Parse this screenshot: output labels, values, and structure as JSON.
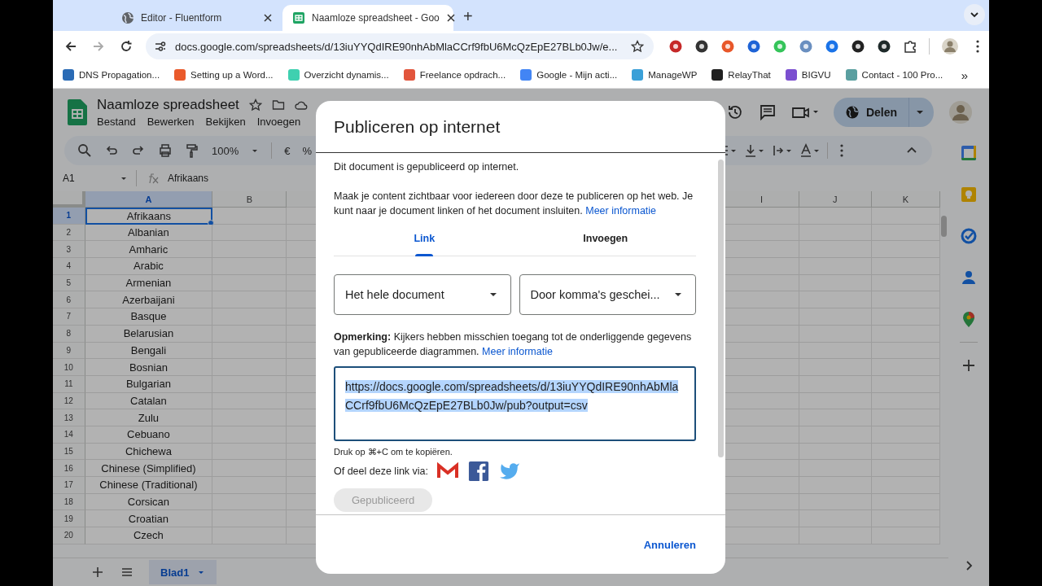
{
  "browser": {
    "tabs": [
      {
        "title": "Editor - Fluentform",
        "kind": "globe",
        "selected": false
      },
      {
        "title": "Naamloze spreadsheet - Goo",
        "kind": "sheets",
        "selected": true
      }
    ],
    "new_tab": "+",
    "url": "docs.google.com/spreadsheets/d/13iuYYQdIRE90nhAbMlaCCrf9fbU6McQzEpE27BLb0Jw/e...",
    "bookmarks": [
      {
        "label": "DNS Propagation...",
        "color": "#2a6bb5"
      },
      {
        "label": "Setting up a Word...",
        "color": "#ea5a2b"
      },
      {
        "label": "Overzicht dynamis...",
        "color": "#3fd0b0"
      },
      {
        "label": "Freelance opdrach...",
        "color": "#e2553c"
      },
      {
        "label": "Google - Mijn acti...",
        "color": "#4285f4"
      },
      {
        "label": "ManageWP",
        "color": "#3aa0d8"
      },
      {
        "label": "RelayThat",
        "color": "#202020"
      },
      {
        "label": "BIGVU",
        "color": "#7b4fd0"
      },
      {
        "label": "Contact - 100 Pro...",
        "color": "#5a9fa0"
      }
    ],
    "more_bookmarks": "»"
  },
  "sheet": {
    "title": "Naamloze spreadsheet",
    "menu": [
      "Bestand",
      "Bewerken",
      "Bekijken",
      "Invoegen"
    ],
    "zoom": "100%",
    "currency": "€",
    "percent": "%",
    "share_button": "Delen",
    "cell_ref": "A1",
    "formula": "Afrikaans",
    "columns": [
      {
        "label": "A",
        "selected": true
      },
      {
        "label": "B",
        "selected": false
      },
      {
        "label": "I",
        "selected": false
      },
      {
        "label": "J",
        "selected": false
      },
      {
        "label": "K",
        "selected": false
      }
    ],
    "rows": [
      {
        "number": "1",
        "value": "Afrikaans",
        "selected": true
      },
      {
        "number": "2",
        "value": "Albanian",
        "selected": false
      },
      {
        "number": "3",
        "value": "Amharic",
        "selected": false
      },
      {
        "number": "4",
        "value": "Arabic",
        "selected": false
      },
      {
        "number": "5",
        "value": "Armenian",
        "selected": false
      },
      {
        "number": "6",
        "value": "Azerbaijani",
        "selected": false
      },
      {
        "number": "7",
        "value": "Basque",
        "selected": false
      },
      {
        "number": "8",
        "value": "Belarusian",
        "selected": false
      },
      {
        "number": "9",
        "value": "Bengali",
        "selected": false
      },
      {
        "number": "10",
        "value": "Bosnian",
        "selected": false
      },
      {
        "number": "11",
        "value": "Bulgarian",
        "selected": false
      },
      {
        "number": "12",
        "value": "Catalan",
        "selected": false
      },
      {
        "number": "13",
        "value": "Zulu",
        "selected": false
      },
      {
        "number": "14",
        "value": "Cebuano",
        "selected": false
      },
      {
        "number": "15",
        "value": "Chichewa",
        "selected": false
      },
      {
        "number": "16",
        "value": "Chinese (Simplified)",
        "selected": false
      },
      {
        "number": "17",
        "value": "Chinese (Traditional)",
        "selected": false
      },
      {
        "number": "18",
        "value": "Corsican",
        "selected": false
      },
      {
        "number": "19",
        "value": "Croatian",
        "selected": false
      },
      {
        "number": "20",
        "value": "Czech",
        "selected": false
      }
    ],
    "sheet_tab": "Blad1"
  },
  "dialog": {
    "title": "Publiceren op internet",
    "status": "Dit document is gepubliceerd op internet.",
    "description": "Maak je content zichtbaar voor iedereen door deze te publiceren op het web. Je kunt naar je document linken of het document insluiten.",
    "description_link": "Meer informatie",
    "tabs": [
      {
        "label": "Link",
        "selected": true
      },
      {
        "label": "Invoegen",
        "selected": false
      }
    ],
    "dropdowns": [
      "Het hele document",
      "Door komma's geschei..."
    ],
    "note": "**Opmerking:** Kijkers hebben misschien toegang tot de onderliggende gegevens van gepubliceerde diagrammen.",
    "note_link": "Meer informatie",
    "url": "https://docs.google.com/spreadsheets/d/13iuYYQdIRE90nhAbMlaCCrf9fbU6McQzEpE27BLb0Jw/pub?output=csv",
    "copy_hint": "Druk op ⌘+C om te kopiëren.",
    "share_label": "Of deel deze link via:",
    "publish_button": {
      "label": "Gepubliceerd",
      "disabled": true
    },
    "cancel_button": "Annuleren"
  }
}
